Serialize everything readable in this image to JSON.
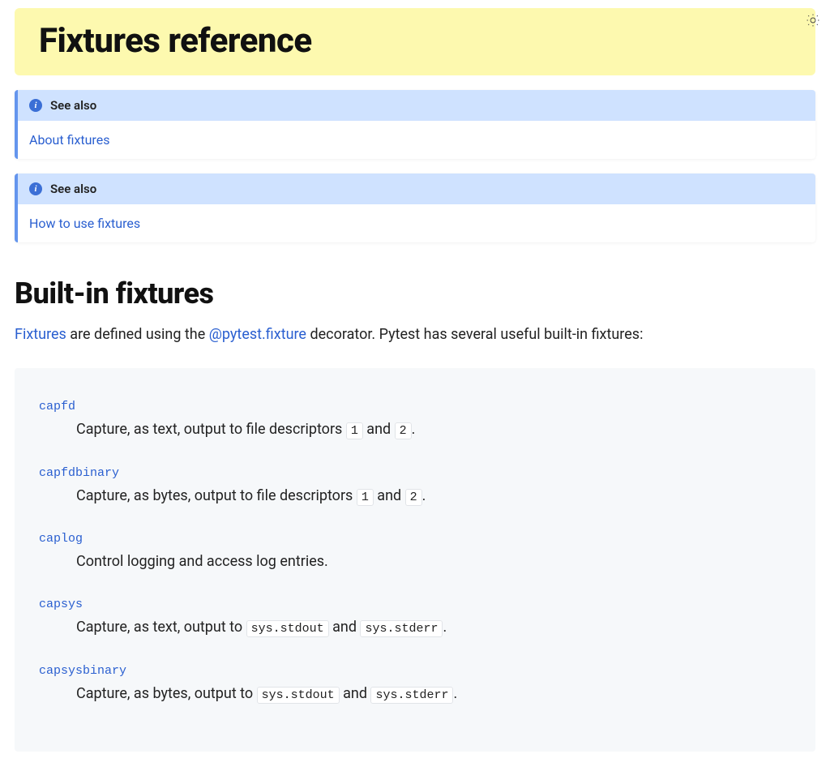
{
  "page": {
    "title": "Fixtures reference"
  },
  "admonitions": [
    {
      "label": "See also",
      "link_text": "About fixtures"
    },
    {
      "label": "See also",
      "link_text": "How to use fixtures"
    }
  ],
  "section": {
    "title": "Built-in fixtures",
    "intro_link1": "Fixtures",
    "intro_text1": " are defined using the ",
    "intro_link2": "@pytest.fixture",
    "intro_text2": " decorator. Pytest has several useful built-in fixtures:"
  },
  "fixtures": [
    {
      "name": "capfd",
      "desc_prefix": "Capture, as text, output to file descriptors ",
      "code1": "1",
      "mid": " and ",
      "code2": "2",
      "suffix": "."
    },
    {
      "name": "capfdbinary",
      "desc_prefix": "Capture, as bytes, output to file descriptors ",
      "code1": "1",
      "mid": " and ",
      "code2": "2",
      "suffix": "."
    },
    {
      "name": "caplog",
      "desc_plain": "Control logging and access log entries."
    },
    {
      "name": "capsys",
      "desc_prefix": "Capture, as text, output to ",
      "code1": "sys.stdout",
      "mid": " and ",
      "code2": "sys.stderr",
      "suffix": "."
    },
    {
      "name": "capsysbinary",
      "desc_prefix": "Capture, as bytes, output to ",
      "code1": "sys.stdout",
      "mid": " and ",
      "code2": "sys.stderr",
      "suffix": "."
    }
  ]
}
